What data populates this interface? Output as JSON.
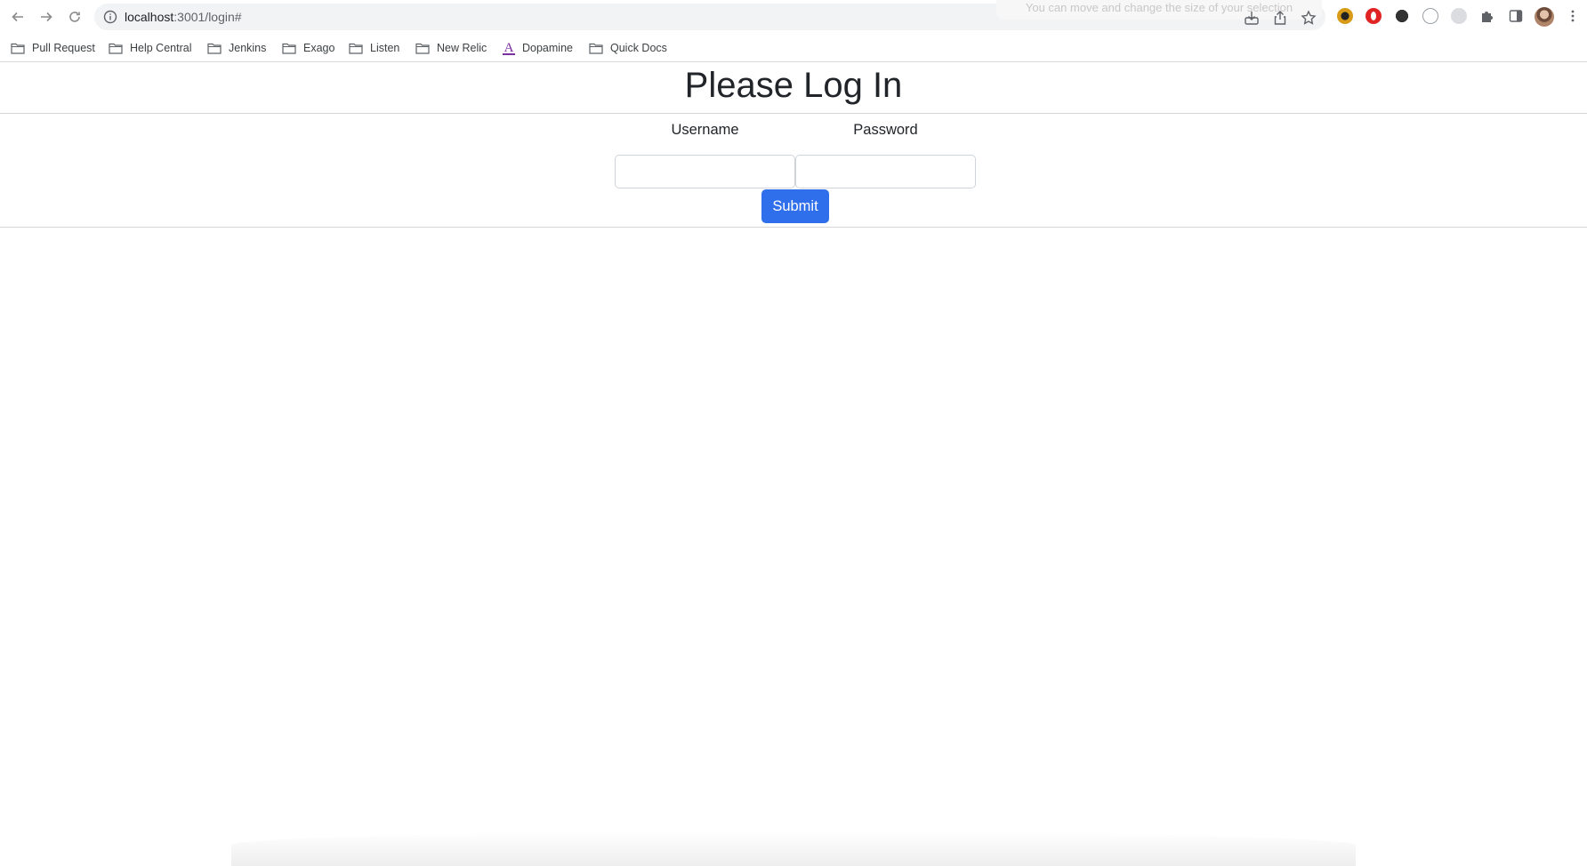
{
  "browser": {
    "url_host": "localhost",
    "url_rest": ":3001/login#",
    "ghost_tooltip": "You can move and change the size of your selection"
  },
  "bookmarks": [
    {
      "label": "Pull Request",
      "icon": "folder-icon"
    },
    {
      "label": "Help Central",
      "icon": "folder-icon"
    },
    {
      "label": "Jenkins",
      "icon": "folder-icon"
    },
    {
      "label": "Exago",
      "icon": "folder-icon"
    },
    {
      "label": "Listen",
      "icon": "folder-icon"
    },
    {
      "label": "New Relic",
      "icon": "folder-icon"
    },
    {
      "label": "Dopamine",
      "icon": "a-logo-icon"
    },
    {
      "label": "Quick Docs",
      "icon": "folder-icon"
    }
  ],
  "page": {
    "title": "Please Log In",
    "username_label": "Username",
    "password_label": "Password",
    "username_value": "",
    "password_value": "",
    "submit_label": "Submit"
  },
  "colors": {
    "accent": "#2f6fec",
    "text": "#212529"
  }
}
